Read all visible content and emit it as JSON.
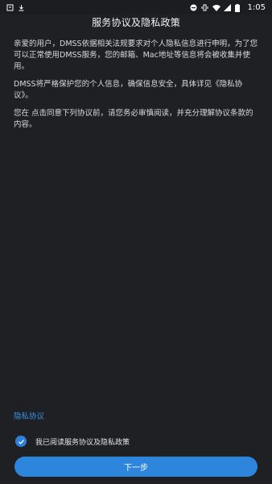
{
  "status_bar": {
    "time": "1:05"
  },
  "page": {
    "title": "服务协议及隐私政策",
    "paragraphs": [
      "亲爱的用户，DMSS依据相关法规要求对个人隐私信息进行申明，为了您可以正常使用DMSS服务，您的邮箱、Mac地址等信息将会被收集并使用。",
      "DMSS将严格保护您的个人信息，确保信息安全，具体详见《隐私协议》。",
      "您在 点击同意下列协议前，请您务必审慎阅读，并充分理解协议条款的内容。"
    ],
    "privacy_link": "隐私协议",
    "agree_label": "我已阅读服务协议及隐私政策",
    "agree_checked": true,
    "next_button": "下一步"
  },
  "colors": {
    "background": "#1e2024",
    "accent": "#2e86dc",
    "link": "#3c8fe6"
  }
}
